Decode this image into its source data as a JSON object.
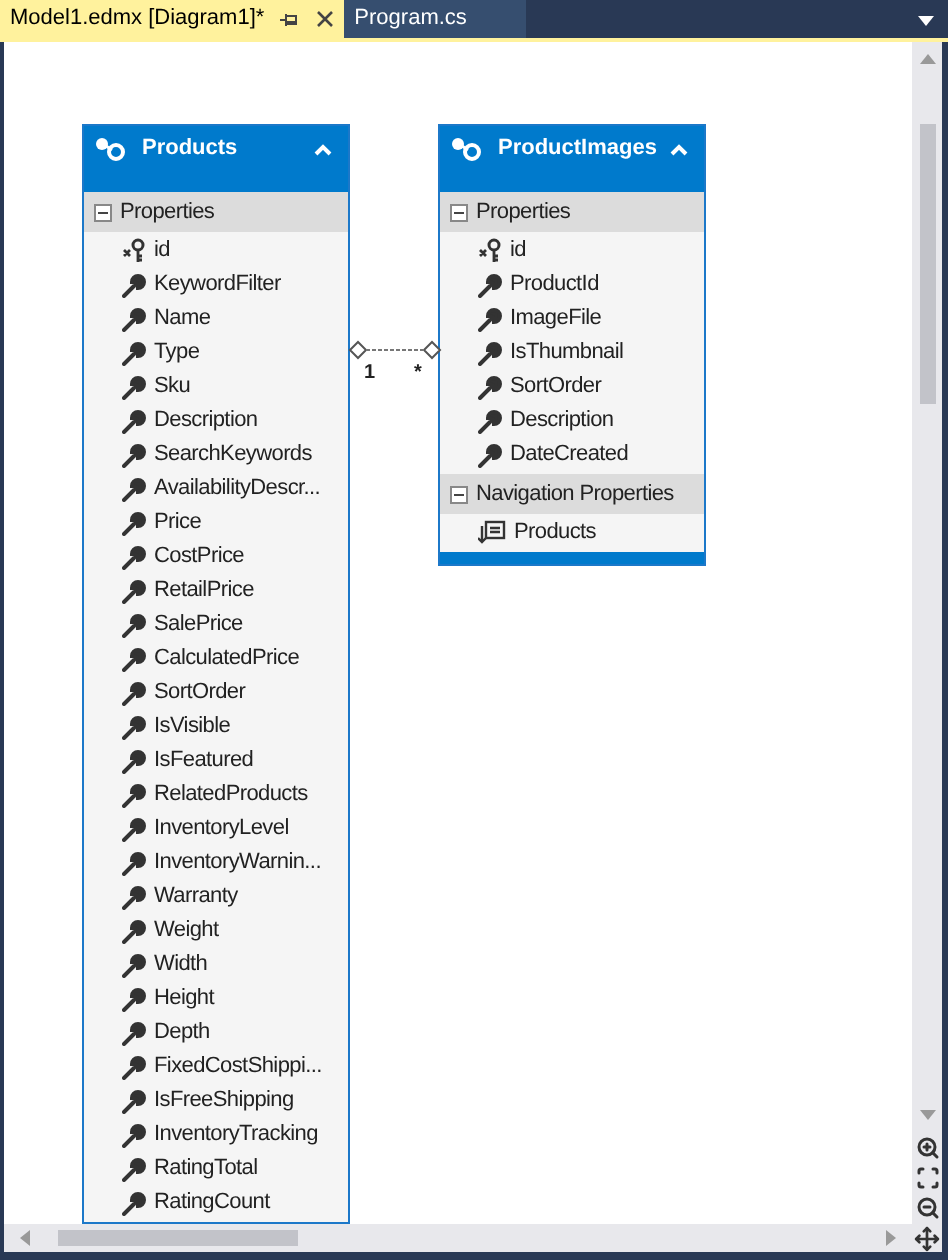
{
  "tabs": [
    {
      "label": "Model1.edmx [Diagram1]*",
      "selected": true
    },
    {
      "label": "Program.cs",
      "selected": false
    }
  ],
  "entities": [
    {
      "name": "Products",
      "expanded": true,
      "sections": [
        {
          "title": "Properties",
          "expanded": true,
          "items": [
            {
              "name": "id",
              "kind": "key"
            },
            {
              "name": "KeywordFilter",
              "kind": "scalar"
            },
            {
              "name": "Name",
              "kind": "scalar"
            },
            {
              "name": "Type",
              "kind": "scalar"
            },
            {
              "name": "Sku",
              "kind": "scalar"
            },
            {
              "name": "Description",
              "kind": "scalar"
            },
            {
              "name": "SearchKeywords",
              "kind": "scalar"
            },
            {
              "name": "AvailabilityDescr...",
              "kind": "scalar"
            },
            {
              "name": "Price",
              "kind": "scalar"
            },
            {
              "name": "CostPrice",
              "kind": "scalar"
            },
            {
              "name": "RetailPrice",
              "kind": "scalar"
            },
            {
              "name": "SalePrice",
              "kind": "scalar"
            },
            {
              "name": "CalculatedPrice",
              "kind": "scalar"
            },
            {
              "name": "SortOrder",
              "kind": "scalar"
            },
            {
              "name": "IsVisible",
              "kind": "scalar"
            },
            {
              "name": "IsFeatured",
              "kind": "scalar"
            },
            {
              "name": "RelatedProducts",
              "kind": "scalar"
            },
            {
              "name": "InventoryLevel",
              "kind": "scalar"
            },
            {
              "name": "InventoryWarnin...",
              "kind": "scalar"
            },
            {
              "name": "Warranty",
              "kind": "scalar"
            },
            {
              "name": "Weight",
              "kind": "scalar"
            },
            {
              "name": "Width",
              "kind": "scalar"
            },
            {
              "name": "Height",
              "kind": "scalar"
            },
            {
              "name": "Depth",
              "kind": "scalar"
            },
            {
              "name": "FixedCostShippi...",
              "kind": "scalar"
            },
            {
              "name": "IsFreeShipping",
              "kind": "scalar"
            },
            {
              "name": "InventoryTracking",
              "kind": "scalar"
            },
            {
              "name": "RatingTotal",
              "kind": "scalar"
            },
            {
              "name": "RatingCount",
              "kind": "scalar"
            }
          ]
        }
      ]
    },
    {
      "name": "ProductImages",
      "expanded": true,
      "sections": [
        {
          "title": "Properties",
          "expanded": true,
          "items": [
            {
              "name": "id",
              "kind": "key"
            },
            {
              "name": "ProductId",
              "kind": "scalar"
            },
            {
              "name": "ImageFile",
              "kind": "scalar"
            },
            {
              "name": "IsThumbnail",
              "kind": "scalar"
            },
            {
              "name": "SortOrder",
              "kind": "scalar"
            },
            {
              "name": "Description",
              "kind": "scalar"
            },
            {
              "name": "DateCreated",
              "kind": "scalar"
            }
          ]
        },
        {
          "title": "Navigation Properties",
          "expanded": true,
          "items": [
            {
              "name": "Products",
              "kind": "navigation"
            }
          ]
        }
      ]
    }
  ],
  "association": {
    "from_multiplicity": "1",
    "to_multiplicity": "*"
  }
}
